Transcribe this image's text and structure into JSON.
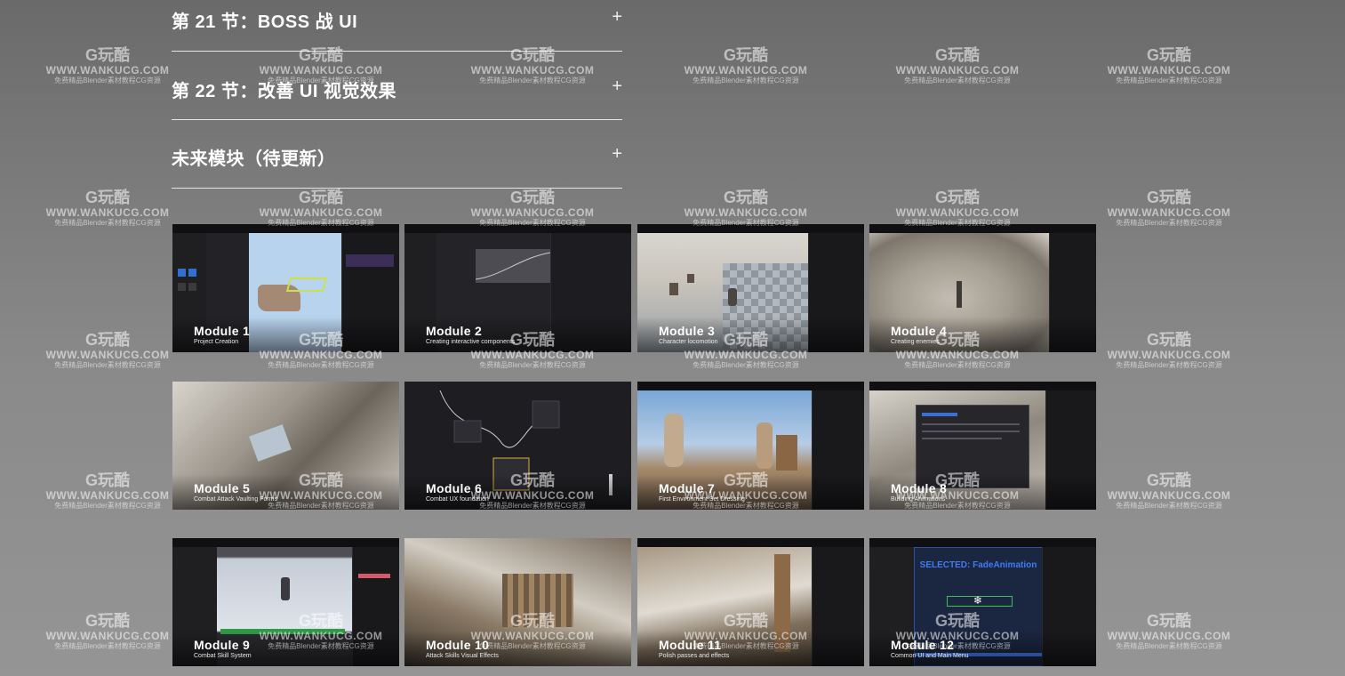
{
  "accordion": {
    "items": [
      {
        "title": "第 21 节：BOSS 战 UI",
        "toggle": "+"
      },
      {
        "title": "第 22 节：改善 UI 视觉效果",
        "toggle": "+"
      },
      {
        "title": "未来模块（待更新）",
        "toggle": "+"
      }
    ]
  },
  "modules": [
    {
      "name": "Module 1",
      "subtitle": "Project Creation"
    },
    {
      "name": "Module 2",
      "subtitle": "Creating interactive components"
    },
    {
      "name": "Module 3",
      "subtitle": "Character locomotion"
    },
    {
      "name": "Module 4",
      "subtitle": "Creating enemies"
    },
    {
      "name": "Module 5",
      "subtitle": "Combat Attack Vaulting Forms"
    },
    {
      "name": "Module 6",
      "subtitle": "Combat UX foundation"
    },
    {
      "name": "Module 7",
      "subtitle": "First Environment Set Dressing"
    },
    {
      "name": "Module 8",
      "subtitle": "Building Animations"
    },
    {
      "name": "Module 9",
      "subtitle": "Combat Skill System"
    },
    {
      "name": "Module 10",
      "subtitle": "Attack Skills Visual Effects"
    },
    {
      "name": "Module 11",
      "subtitle": "Polish passes and effects"
    },
    {
      "name": "Module 12",
      "subtitle": "Common UI and Main Menu"
    }
  ],
  "card12_overlay": "SELECTED: FadeAnimation",
  "watermark": {
    "logo": "玩酷",
    "url": "WWW.WANKUCG.COM",
    "sub": "免费精品Blender素材教程CG资源"
  },
  "colors": {
    "text": "#ffffff",
    "divider": "#e6e6e6",
    "background_top": "#6a6a6a",
    "background_bottom": "#959595"
  }
}
